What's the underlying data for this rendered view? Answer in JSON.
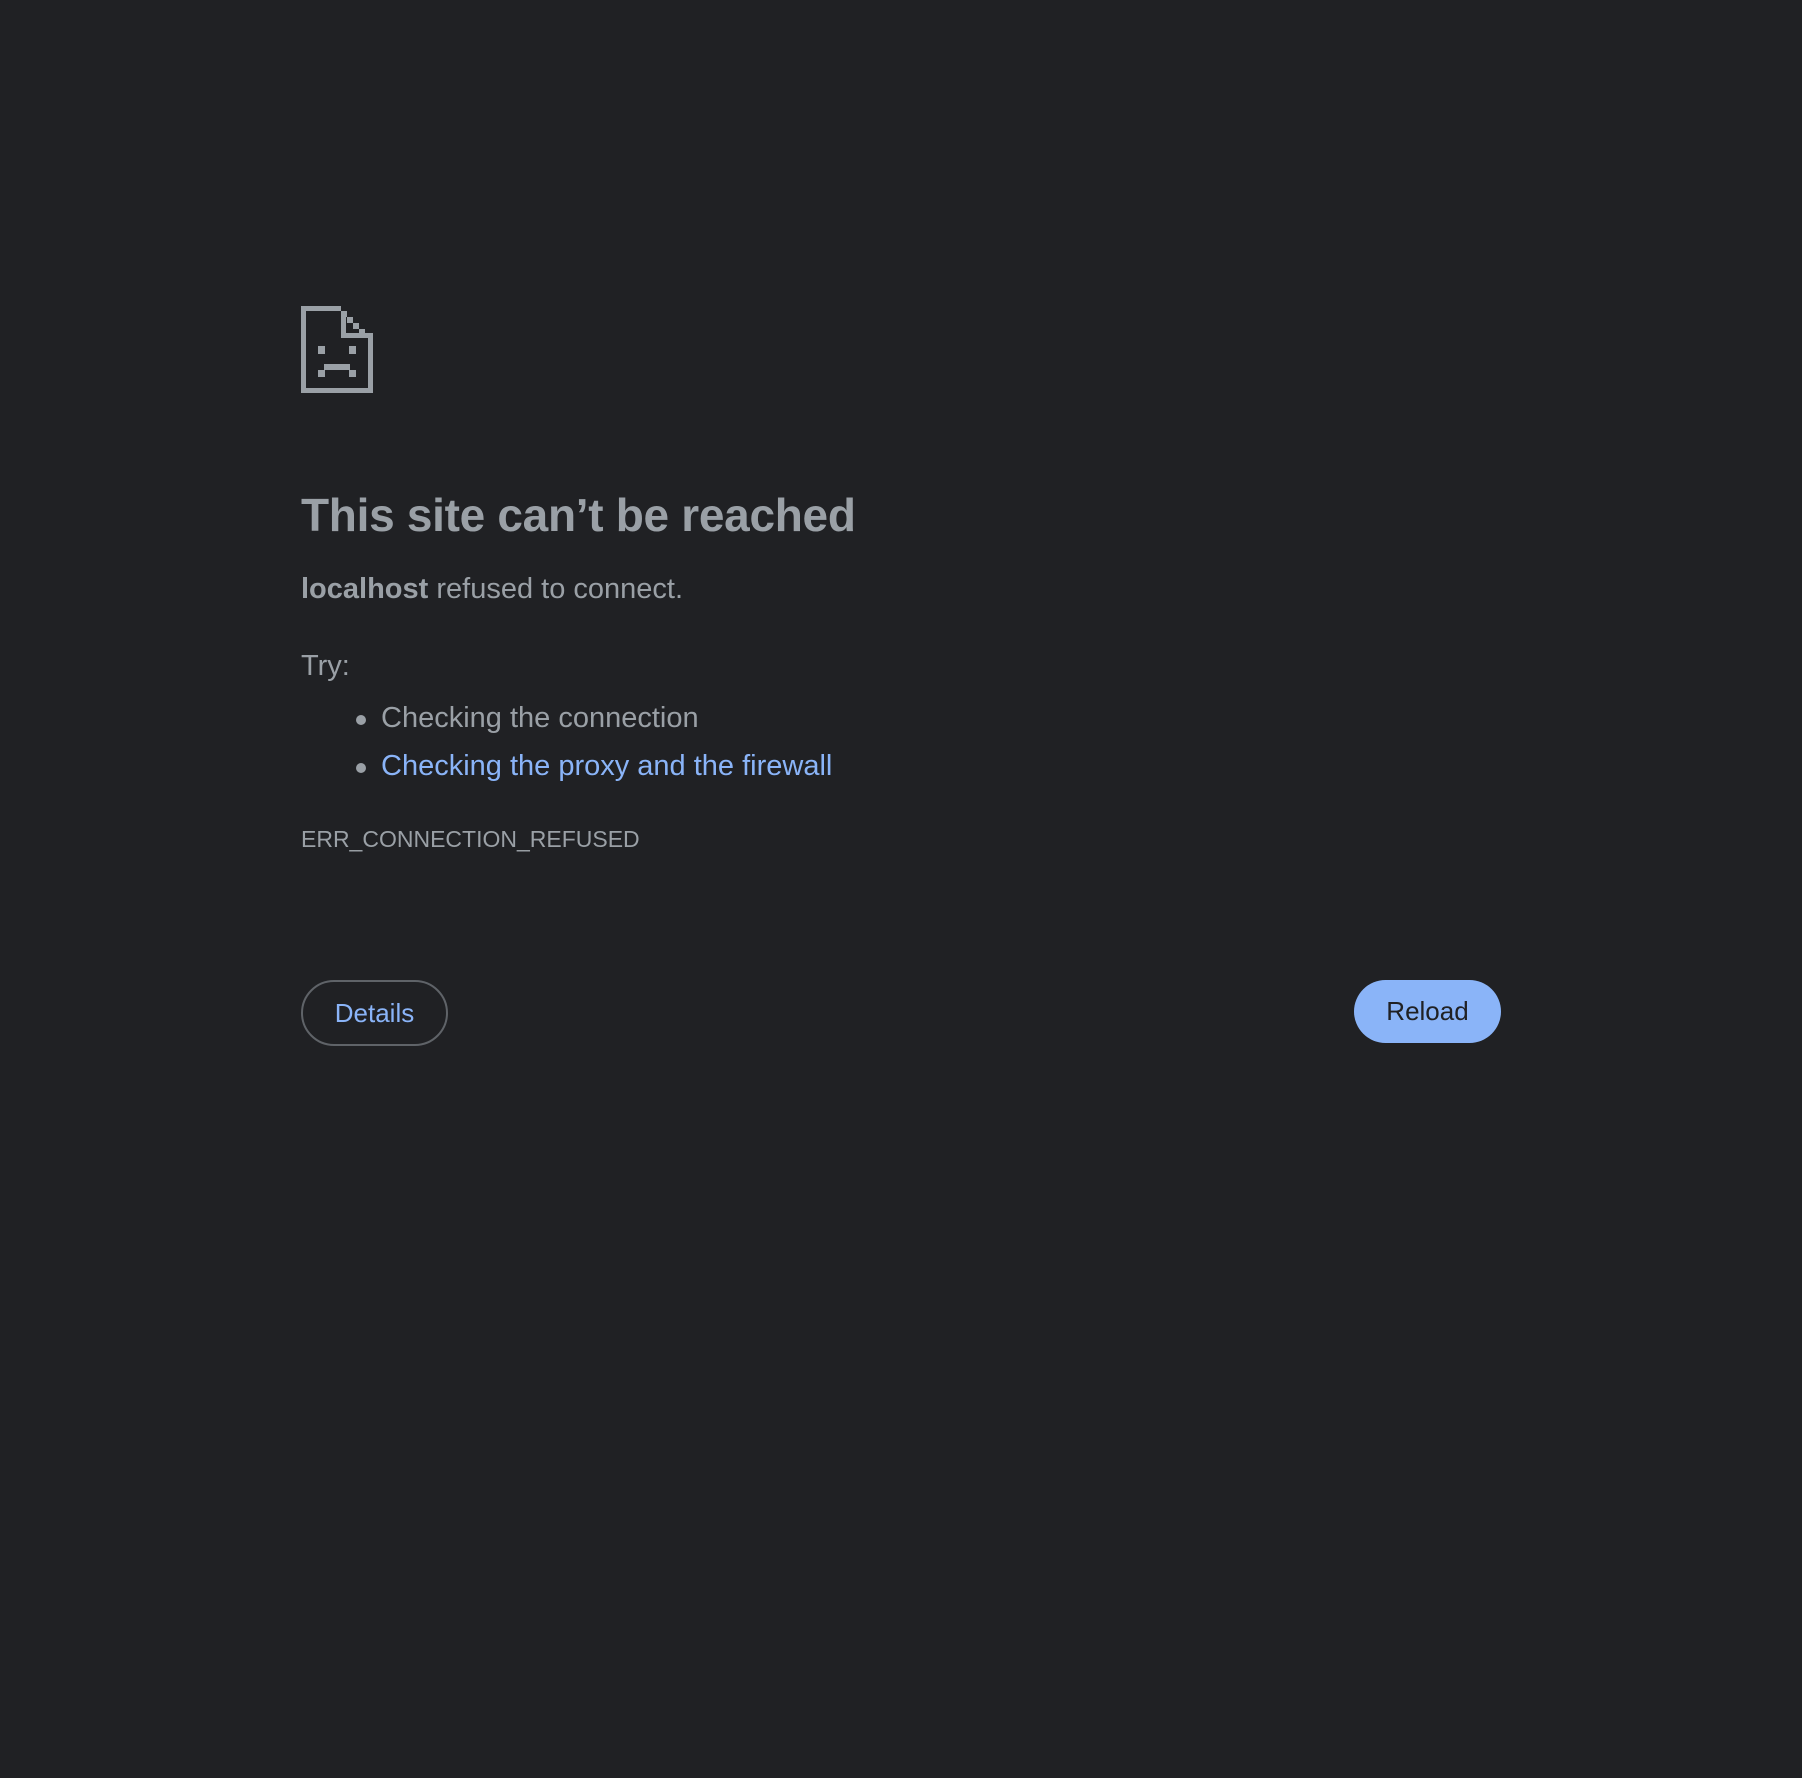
{
  "page": {
    "background_color": "#202124",
    "text_color": "#9aa0a6",
    "link_color": "#8ab4f8"
  },
  "icon": {
    "name": "sad-page-icon"
  },
  "error": {
    "title": "This site can’t be reached",
    "host": "localhost",
    "summary_suffix": " refused to connect.",
    "try_label": "Try:",
    "suggestions": [
      {
        "text": "Checking the connection",
        "is_link": false
      },
      {
        "text": "Checking the proxy and the firewall",
        "is_link": true
      }
    ],
    "code": "ERR_CONNECTION_REFUSED"
  },
  "buttons": {
    "details_label": "Details",
    "reload_label": "Reload"
  }
}
